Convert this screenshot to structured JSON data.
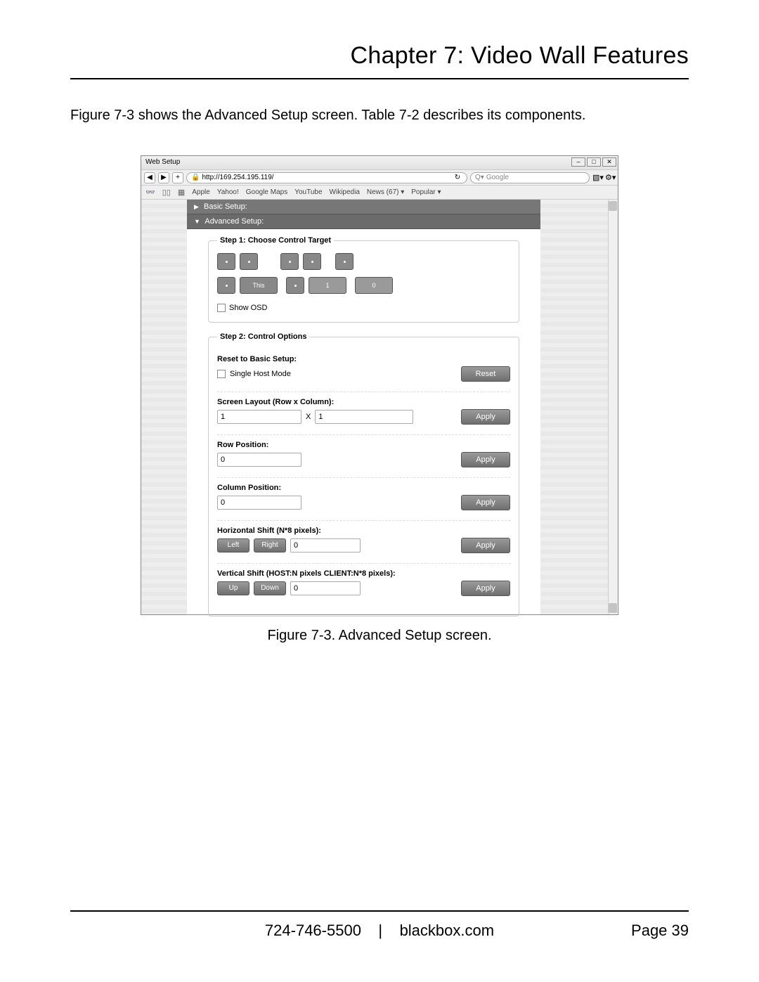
{
  "chapter_title": "Chapter 7: Video Wall Features",
  "lead": "Figure 7-3 shows the Advanced Setup screen. Table 7-2 describes its components.",
  "browser": {
    "window_title": "Web Setup",
    "url": "http://169.254.195.119/",
    "reload_icon": "↻",
    "search_placeholder": "Google",
    "search_prefix": "Q▾",
    "bookmarks": [
      "Apple",
      "Yahoo!",
      "Google Maps",
      "YouTube",
      "Wikipedia",
      "News (67) ▾",
      "Popular ▾"
    ]
  },
  "tabs": {
    "basic": "Basic Setup:",
    "advanced": "Advanced Setup:"
  },
  "step1": {
    "legend": "Step 1: Choose Control Target",
    "this_label": "This",
    "num1": "1",
    "num0": "0",
    "show_osd": "Show OSD"
  },
  "step2": {
    "legend": "Step 2: Control Options",
    "reset_header": "Reset to Basic Setup:",
    "single_host": "Single Host Mode",
    "reset_btn": "Reset",
    "layout_header": "Screen Layout (Row x Column):",
    "layout_row": "1",
    "layout_x": "X",
    "layout_col": "1",
    "apply": "Apply",
    "rowpos_header": "Row Position:",
    "rowpos_val": "0",
    "colpos_header": "Column Position:",
    "colpos_val": "0",
    "hshift_header": "Horizontal Shift (N*8 pixels):",
    "left": "Left",
    "right": "Right",
    "hshift_val": "0",
    "vshift_header": "Vertical Shift (HOST:N pixels CLIENT:N*8 pixels):",
    "up": "Up",
    "down": "Down",
    "vshift_val": "0"
  },
  "caption": "Figure 7-3. Advanced Setup screen.",
  "footer": {
    "phone": "724-746-5500",
    "sep": "|",
    "site": "blackbox.com",
    "page": "Page 39"
  }
}
